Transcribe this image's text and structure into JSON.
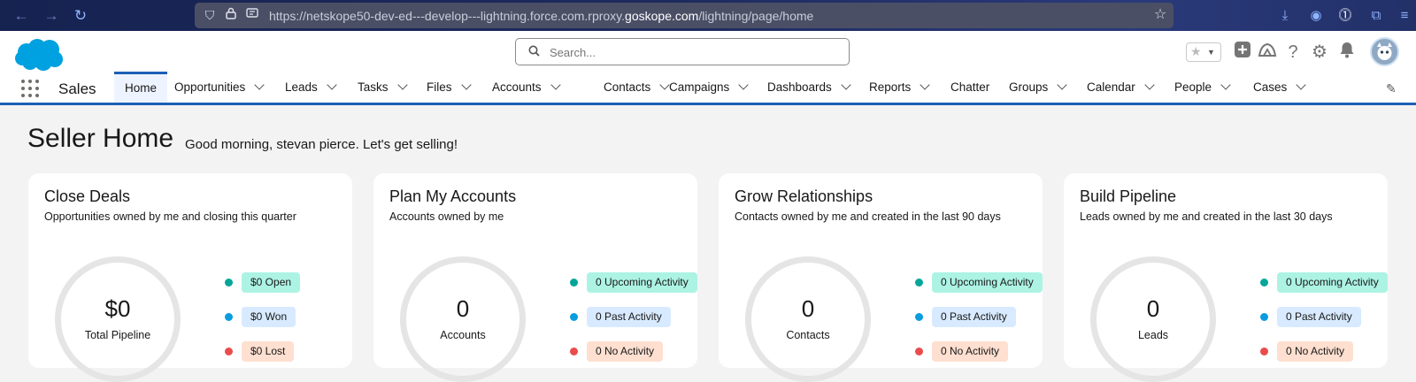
{
  "browser": {
    "url_prefix": "https://netskope50-dev-ed---develop---lightning.force.com.rproxy.",
    "url_domain": "goskope.com",
    "url_suffix": "/lightning/page/home"
  },
  "header": {
    "search_placeholder": "Search...",
    "app_name": "Sales"
  },
  "nav_tabs": [
    {
      "label": "Home",
      "has_menu": false,
      "active": true
    },
    {
      "label": "Opportunities",
      "has_menu": true
    },
    {
      "label": "Leads",
      "has_menu": true
    },
    {
      "label": "Tasks",
      "has_menu": true
    },
    {
      "label": "Files",
      "has_menu": true
    },
    {
      "label": "Accounts",
      "has_menu": true
    },
    {
      "label": "Contacts",
      "has_menu": true
    },
    {
      "label": "Campaigns",
      "has_menu": true
    },
    {
      "label": "Dashboards",
      "has_menu": true
    },
    {
      "label": "Reports",
      "has_menu": true
    },
    {
      "label": "Chatter",
      "has_menu": false
    },
    {
      "label": "Groups",
      "has_menu": true
    },
    {
      "label": "Calendar",
      "has_menu": true
    },
    {
      "label": "People",
      "has_menu": true
    },
    {
      "label": "Cases",
      "has_menu": true
    }
  ],
  "page": {
    "title": "Seller Home",
    "greeting": "Good morning, stevan pierce. Let's get selling!"
  },
  "cards": [
    {
      "title": "Close Deals",
      "subtitle": "Opportunities owned by me and closing this quarter",
      "ring_value": "$0",
      "ring_label": "Total Pipeline",
      "legend": [
        {
          "label": "$0 Open",
          "dot": "#06a59a",
          "bg": "#acf3e4"
        },
        {
          "label": "$0 Won",
          "dot": "#0b9ce0",
          "bg": "#d8eaff"
        },
        {
          "label": "$0 Lost",
          "dot": "#ea4c4c",
          "bg": "#fedfd0"
        }
      ]
    },
    {
      "title": "Plan My Accounts",
      "subtitle": "Accounts owned by me",
      "ring_value": "0",
      "ring_label": "Accounts",
      "legend": [
        {
          "label": "0 Upcoming Activity",
          "dot": "#06a59a",
          "bg": "#acf3e4"
        },
        {
          "label": "0 Past Activity",
          "dot": "#0b9ce0",
          "bg": "#d8eaff"
        },
        {
          "label": "0 No Activity",
          "dot": "#ea4c4c",
          "bg": "#fedfd0"
        }
      ]
    },
    {
      "title": "Grow Relationships",
      "subtitle": "Contacts owned by me and created in the last 90 days",
      "ring_value": "0",
      "ring_label": "Contacts",
      "legend": [
        {
          "label": "0 Upcoming Activity",
          "dot": "#06a59a",
          "bg": "#acf3e4"
        },
        {
          "label": "0 Past Activity",
          "dot": "#0b9ce0",
          "bg": "#d8eaff"
        },
        {
          "label": "0 No Activity",
          "dot": "#ea4c4c",
          "bg": "#fedfd0"
        }
      ]
    },
    {
      "title": "Build Pipeline",
      "subtitle": "Leads owned by me and created in the last 30 days",
      "ring_value": "0",
      "ring_label": "Leads",
      "legend": [
        {
          "label": "0 Upcoming Activity",
          "dot": "#06a59a",
          "bg": "#acf3e4"
        },
        {
          "label": "0 Past Activity",
          "dot": "#0b9ce0",
          "bg": "#d8eaff"
        },
        {
          "label": "0 No Activity",
          "dot": "#ea4c4c",
          "bg": "#fedfd0"
        }
      ]
    }
  ],
  "colors": {
    "brand": "#1b5fb5",
    "salesforce_cloud": "#00a1e0"
  }
}
